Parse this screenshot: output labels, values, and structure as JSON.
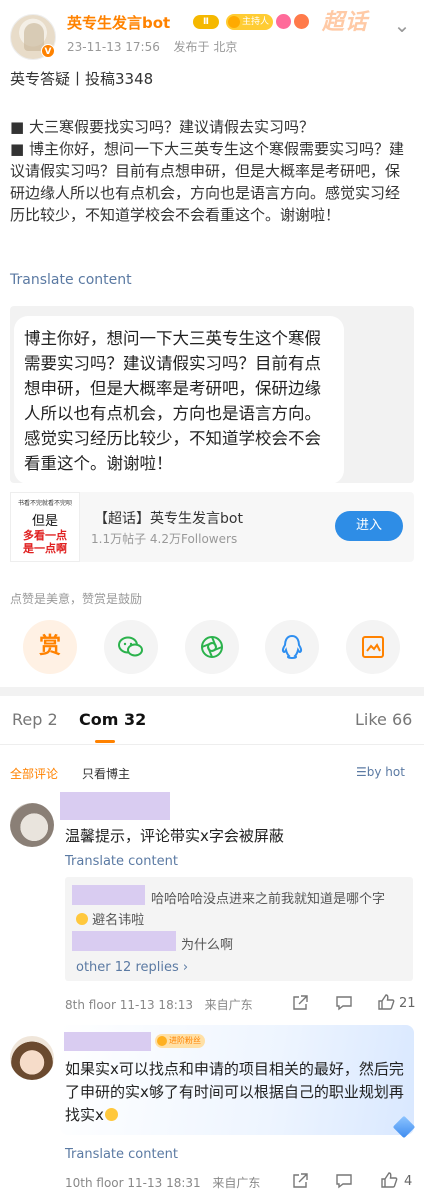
{
  "header": {
    "author": "英专生发言bot",
    "level_badge": "Ⅱ",
    "host_badge": "主持人",
    "supertopic_logo": "超话",
    "verified_mark": "V",
    "time": "23-11-13 17:56",
    "location": "发布于 北京"
  },
  "post": {
    "title": "英专答疑丨投稿3348",
    "body_lines": [
      "■ 大三寒假要找实习吗？建议请假去实习吗？",
      "■ 博主你好，想问一下大三英专生这个寒假需要实习吗？建议请假实习吗？目前有点想申研，但是大概率是考研吧，保研边缘人所以也有点机会，方向也是语言方向。感觉实习经历比较少，不知道学校会不会看重这个。谢谢啦！"
    ],
    "translate": "Translate content",
    "image_text": "博主你好，想问一下大三英专生这个寒假需要实习吗？建议请假实习吗？目前有点想申研，但是大概率是考研吧，保研边缘人所以也有点机会，方向也是语言方向。感觉实习经历比较少，不知道学校会不会看重这个。谢谢啦！"
  },
  "supertopic": {
    "thumb_line1": "书看不完就看不完呗",
    "thumb_line2": "但是",
    "thumb_line3": "多看一点",
    "thumb_line4": "是一点啊",
    "name": "【超话】英专生发言bot",
    "stats": "1.1万帖子 4.2万Followers",
    "join": "进入"
  },
  "encourage": "点赞是美意，赞赏是鼓励",
  "actions": {
    "reward": "赏",
    "icons": [
      "wechat-icon",
      "moments-icon",
      "qq-icon",
      "save-image-icon"
    ]
  },
  "tabs": {
    "repost": "Rep 2",
    "comments": "Com 32",
    "likes": "Like 66"
  },
  "filters": {
    "all": "全部评论",
    "host_only": "只看博主",
    "sort": "by hot"
  },
  "comments": [
    {
      "text": "温馨提示，评论带实x字会被屏蔽",
      "translate": "Translate content",
      "replies": [
        {
          "text": "哈哈哈哈没点进来之前我就知道是哪个字",
          "text2": "避名讳啦"
        },
        {
          "text": "为什么啊"
        }
      ],
      "more_replies": "other 12 replies",
      "floor": "8th floor 11-13 18:13",
      "location": "来自广东",
      "likes": "21"
    },
    {
      "badge": "进阶粉丝",
      "text": "如果实x可以找点和申请的项目相关的最好，然后完了申研的实x够了有时间可以根据自己的职业规划再找实x",
      "translate": "Translate content",
      "floor": "10th floor 11-13 18:31",
      "location": "来自广东",
      "likes": "4"
    }
  ],
  "colors": {
    "accent": "#ff8200",
    "link": "#5b7aa3",
    "join_button": "#2e8de6",
    "name_mask": "#d9ccf1"
  }
}
